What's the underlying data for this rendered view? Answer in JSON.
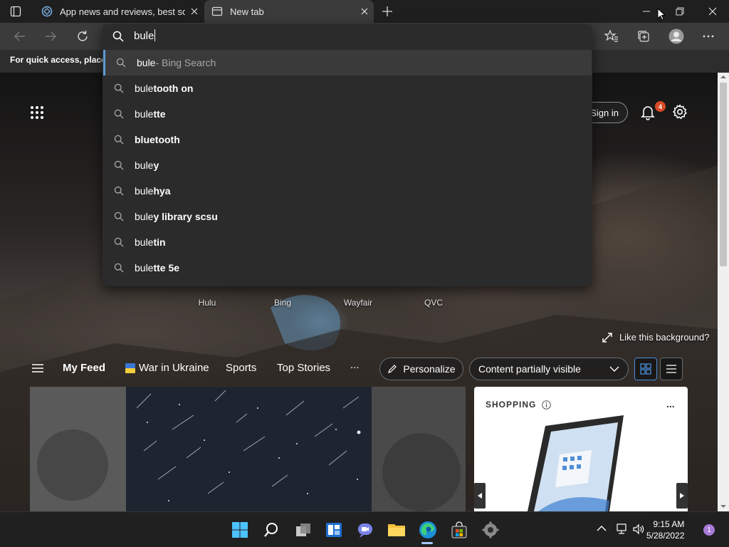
{
  "tabs": [
    {
      "title": "App news and reviews, best software"
    },
    {
      "title": "New tab"
    }
  ],
  "address": {
    "value": "bule"
  },
  "favorites_bar": {
    "text": "For quick access, place y"
  },
  "suggestions": [
    {
      "typed": "bule",
      "rest": " - Bing Search"
    },
    {
      "typed": "bule",
      "rest": "tooth on"
    },
    {
      "typed": "bule",
      "rest": "tte"
    },
    {
      "typed": "",
      "rest": "bluetooth"
    },
    {
      "typed": "bule",
      "rest": "y"
    },
    {
      "typed": "bule",
      "rest": "hya"
    },
    {
      "typed": "bule",
      "rest": "y library scsu"
    },
    {
      "typed": "bule",
      "rest": "tin"
    },
    {
      "typed": "bule",
      "rest": "tte 5e"
    }
  ],
  "header": {
    "sign_in": "Sign in",
    "notifications_count": "4"
  },
  "quick_links": [
    "Hulu",
    "Bing",
    "Wayfair",
    "QVC"
  ],
  "like_background": "Like this background?",
  "feed_nav": {
    "my_feed": "My Feed",
    "ukraine": "War in Ukraine",
    "sports": "Sports",
    "top_stories": "Top Stories",
    "more": "...",
    "personalize": "Personalize",
    "content_visibility": "Content partially visible"
  },
  "shopping": {
    "label": "SHOPPING",
    "more": "..."
  },
  "clock": {
    "time": "9:15 AM",
    "date": "5/28/2022"
  },
  "notification_count": "1",
  "colors": {
    "accent": "#4a8ed6",
    "badge": "#d84b25"
  }
}
